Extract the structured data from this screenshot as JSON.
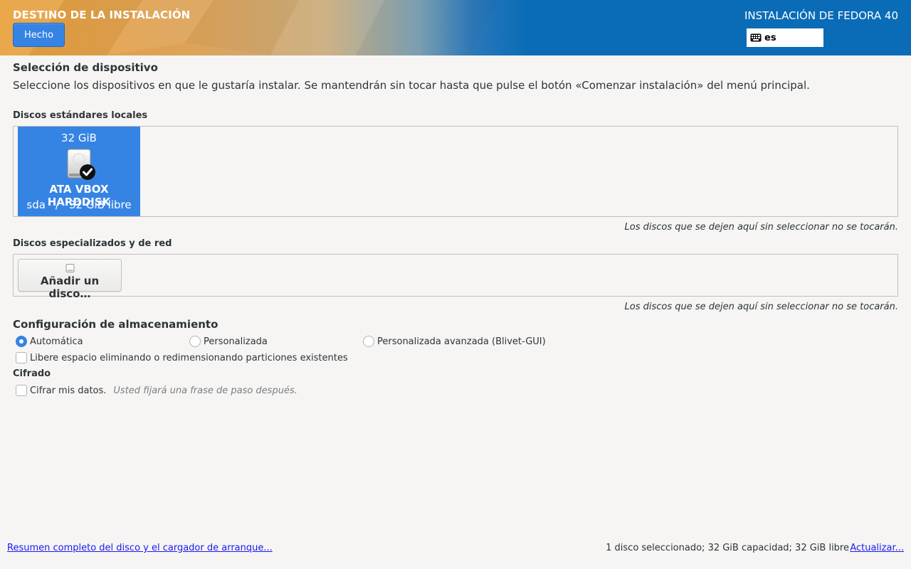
{
  "header": {
    "spoke_title": "DESTINO DE LA INSTALACIÓN",
    "done_label": "Hecho",
    "product_title": "INSTALACIÓN DE FEDORA 40",
    "keyboard_layout": "es",
    "accent_color": "#3584e4"
  },
  "device_selection": {
    "title": "Selección de dispositivo",
    "description": "Seleccione los dispositivos en que le gustaría instalar. Se mantendrán sin tocar hasta que pulse el botón «Comenzar instalación» del menú principal."
  },
  "local_disks": {
    "label": "Discos estándares locales",
    "disks": [
      {
        "capacity": "32 GiB",
        "name": "ATA VBOX HARDDISK",
        "device": "sda",
        "separator": "/",
        "free": "32 GiB libre",
        "selected": true,
        "icon": "harddisk-checked-icon"
      }
    ],
    "note": "Los discos que se dejen aquí sin seleccionar no se tocarán."
  },
  "specialized_disks": {
    "label": "Discos especializados y de red",
    "add_label": "Añadir un disco…",
    "note": "Los discos que se dejen aquí sin seleccionar no se tocarán."
  },
  "storage_config": {
    "title": "Configuración de almacenamiento",
    "options": [
      {
        "label": "Automática",
        "selected": true
      },
      {
        "label": "Personalizada",
        "selected": false
      },
      {
        "label": "Personalizada avanzada (Blivet-GUI)",
        "selected": false
      }
    ],
    "reclaim_label": "Libere espacio eliminando o redimensionando particiones existentes"
  },
  "encryption": {
    "title": "Cifrado",
    "encrypt_label": "Cifrar mis datos.",
    "encrypt_hint": "Usted fijará una frase de paso después."
  },
  "footer": {
    "summary_link": "Resumen completo del disco y el cargador de arranque...",
    "summary_text": "1 disco seleccionado; 32 GiB capacidad; 32 GiB libre",
    "refresh_link": "Actualizar..."
  }
}
